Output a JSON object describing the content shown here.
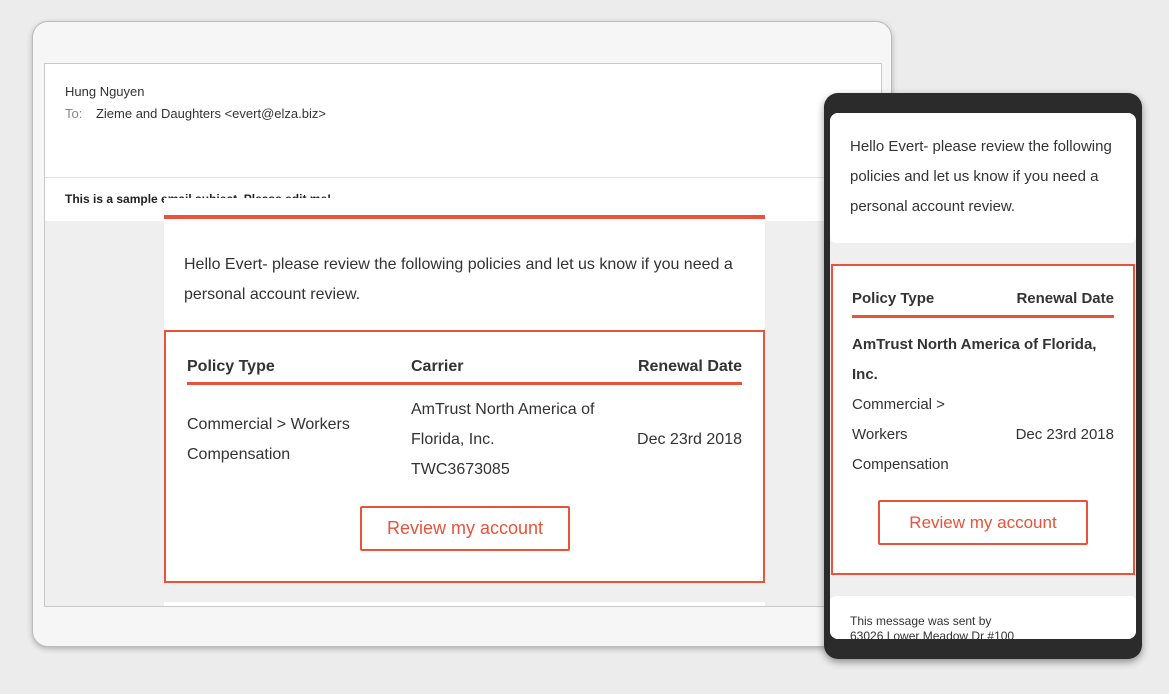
{
  "email": {
    "sender": "Hung Nguyen",
    "to_label": "To:",
    "to_value": "Zieme and Daughters <evert@elza.biz>",
    "subject": "This is a sample email subject. Please edit me!"
  },
  "message": {
    "greeting": "Hello Evert- please review the following policies and let us know if you need a personal account review."
  },
  "policy_table": {
    "headers": {
      "policy_type": "Policy Type",
      "carrier": "Carrier",
      "renewal_date": "Renewal Date"
    },
    "rows": [
      {
        "policy_type": "Commercial > Workers Compensation",
        "carrier_name": "AmTrust North America of Florida, Inc.",
        "policy_number": "TWC3673085",
        "renewal_date": "Dec 23rd 2018"
      }
    ]
  },
  "cta": {
    "label": "Review my account"
  },
  "footer": {
    "line1": "This message was sent by",
    "line2": "63026 Lower Meadow Dr #100"
  },
  "colors": {
    "accent": "#e8533a"
  }
}
